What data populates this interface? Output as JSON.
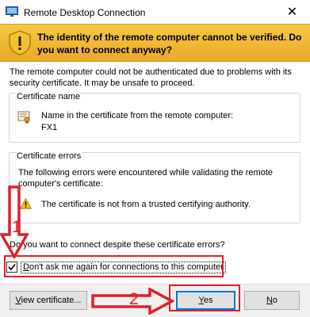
{
  "window": {
    "title": "Remote Desktop Connection",
    "close_glyph": "✕"
  },
  "banner": {
    "text": "The identity of the remote computer cannot be verified. Do you want to connect anyway?",
    "icon": "shield-warning-icon"
  },
  "body_text": "The remote computer could not be authenticated due to problems with its security certificate. It may be unsafe to proceed.",
  "certificate_name": {
    "legend": "Certificate name",
    "label": "Name in the certificate from the remote computer:",
    "value": "FX1",
    "icon": "certificate-icon"
  },
  "certificate_errors": {
    "legend": "Certificate errors",
    "text": "The following errors were encountered while validating the remote computer's certificate:",
    "item": "The certificate is not from a trusted certifying authority.",
    "icon": "warning-icon"
  },
  "question": "Do you want to connect despite these certificate errors?",
  "checkbox": {
    "label": "Don't ask me again for connections to this computer",
    "checked": true
  },
  "buttons": {
    "view_certificate": "View certificate...",
    "yes": "Yes",
    "no": "No"
  },
  "annotations": {
    "step1": "1",
    "step2": "2",
    "color": "#e0202a"
  }
}
